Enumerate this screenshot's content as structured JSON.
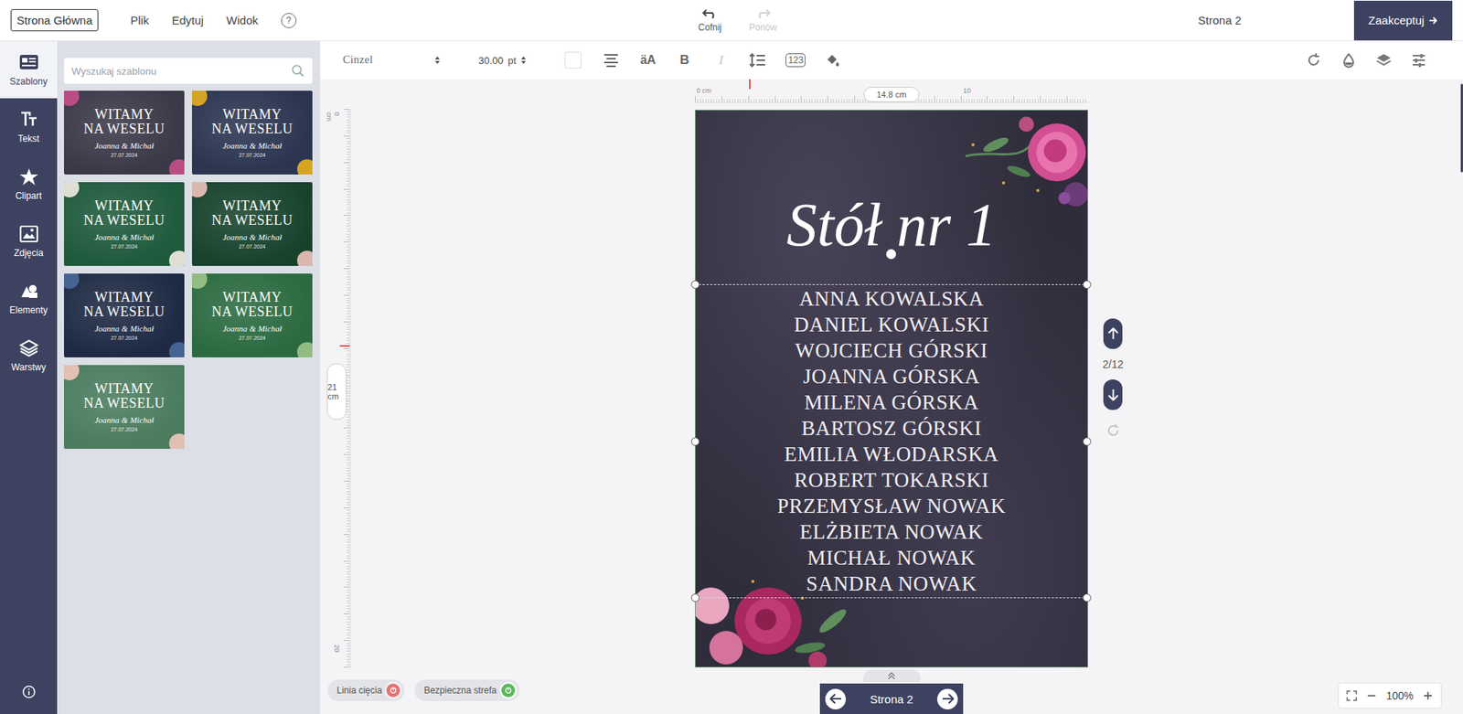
{
  "topbar": {
    "home_button": "Strona Główna",
    "menus": [
      "Plik",
      "Edytuj",
      "Widok"
    ],
    "help": "?",
    "history": [
      {
        "label": "Cofnij",
        "disabled": false
      },
      {
        "label": "Ponów",
        "disabled": true
      }
    ],
    "page_label": "Strona 2",
    "accept_button": "Zaakceptuj"
  },
  "rail": [
    {
      "label": "Szablony",
      "selected": true
    },
    {
      "label": "Tekst",
      "selected": false
    },
    {
      "label": "Clipart",
      "selected": false
    },
    {
      "label": "Zdjęcia",
      "selected": false
    },
    {
      "label": "Elementy",
      "selected": false
    },
    {
      "label": "Warstwy",
      "selected": false
    }
  ],
  "templates": {
    "search_placeholder": "Wyszukaj szablonu",
    "items": [
      {
        "line1": "WITAMY",
        "line2": "NA WESELU",
        "names": "Joanna & Michał",
        "date": "27.07.2024",
        "color": "#3b3848",
        "accent": "#c8508a"
      },
      {
        "line1": "WITAMY",
        "line2": "NA WESELU",
        "names": "Joanna & Michał",
        "date": "27.07.2024",
        "color": "#2b3550",
        "accent": "#e8b020"
      },
      {
        "line1": "WITAMY",
        "line2": "NA WESELU",
        "names": "Joanna & Michał",
        "date": "27.07.2024",
        "color": "#1f5a3c",
        "accent": "#f3ede2"
      },
      {
        "line1": "WITAMY",
        "line2": "NA WESELU",
        "names": "Joanna & Michał",
        "date": "27.07.2024",
        "color": "#17432d",
        "accent": "#f0c4bc"
      },
      {
        "line1": "WITAMY",
        "line2": "NA WESELU",
        "names": "Joanna & Michał",
        "date": "27.07.2024",
        "color": "#1e2a44",
        "accent": "#4a6a9a"
      },
      {
        "line1": "WITAMY",
        "line2": "NA WESELU",
        "names": "Joanna & Michał",
        "date": "27.07.2024",
        "color": "#2b6a40",
        "accent": "#9cc48a"
      },
      {
        "line1": "WITAMY",
        "line2": "NA WESELU",
        "names": "Joanna & Michał",
        "date": "27.07.2024",
        "color": "#4b7c5e",
        "accent": "#f2c8bc"
      }
    ]
  },
  "toolbar": {
    "font": "Cinzel",
    "size": "30.00",
    "unit": "pt",
    "color": "#ffffff",
    "case_icon": "äA",
    "bold": "B",
    "italic": "I",
    "italic_disabled": true,
    "numbers": "123"
  },
  "rulers": {
    "width": "14.8 cm",
    "h_ticks": [
      "0 cm",
      "10"
    ],
    "height": "21 cm",
    "v_ticks": [
      "0 cm",
      "20"
    ]
  },
  "page": {
    "title": "Stół nr 1",
    "names": [
      "ANNA KOWALSKA",
      "DANIEL KOWALSKI",
      "WOJCIECH GÓRSKI",
      "JOANNA GÓRSKA",
      "MILENA GÓRSKA",
      "BARTOSZ GÓRSKI",
      "EMILIA WŁODARSKA",
      "ROBERT TOKARSKI",
      "PRZEMYSŁAW NOWAK",
      "ELŻBIETA NOWAK",
      "MICHAŁ NOWAK",
      "SANDRA NOWAK"
    ],
    "text_selected": true
  },
  "side": {
    "counter": "2/12"
  },
  "guides": [
    {
      "label": "Linia cięcia",
      "on": false,
      "color": "#e57373"
    },
    {
      "label": "Bezpieczna strefa",
      "on": true,
      "color": "#5cb85c"
    }
  ],
  "nav": {
    "label": "Strona 2"
  },
  "zoom": {
    "value": "100%"
  }
}
